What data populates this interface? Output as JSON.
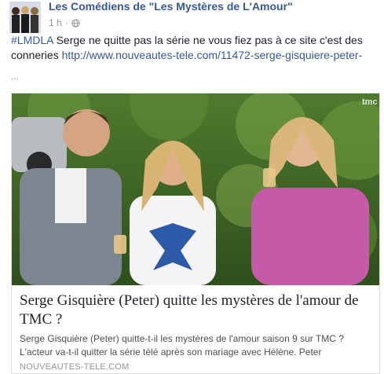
{
  "post": {
    "page_name": "Les Comédiens de \"Les Mystères de L'Amour\"",
    "timestamp": "1 h",
    "separator": "·",
    "privacy_icon": "globe-icon",
    "hashtag": "#LMDLA",
    "text": " Serge ne quitte pas la série ne vous fiez pas à ce site c'est des conneries ",
    "link_text": "http://www.nouveautes-tele.com/11472-serge-gisquiere-peter-",
    "ellipsis": "..."
  },
  "card": {
    "image_watermark": "tmc",
    "title": "Serge Gisquière (Peter) quitte les mystères de l'amour de TMC ?",
    "description": "Serge Gisquière (Peter) quitte-t-il les mystères de l'amour saison 9 sur TMC ? L'acteur va-t-il quitter la série télé après son mariage avec Hélène. Peter",
    "domain": "NOUVEAUTES-TELE.COM"
  },
  "colors": {
    "link": "#365899",
    "text": "#1d2129",
    "muted": "#90949c",
    "border": "#dddfe2"
  }
}
